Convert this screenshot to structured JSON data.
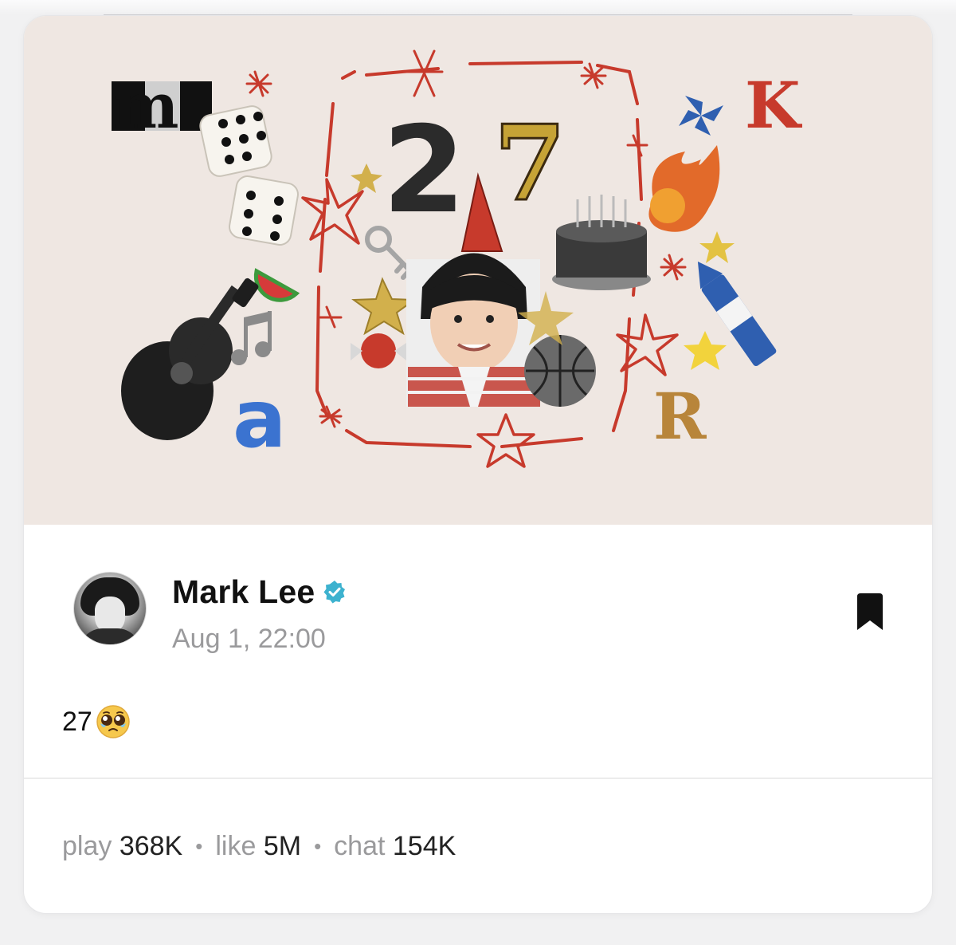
{
  "post": {
    "author_name": "Mark Lee",
    "timestamp": "Aug 1, 22:00",
    "text": "27",
    "emoji": "pleading-face-with-tears",
    "verified": true,
    "banner": {
      "letters": [
        "m",
        "a",
        "K",
        "R"
      ],
      "number": "27"
    }
  },
  "stats": {
    "play_label": "play",
    "play_value": "368K",
    "like_label": "like",
    "like_value": "5M",
    "chat_label": "chat",
    "chat_value": "154K",
    "separator": "•"
  },
  "colors": {
    "banner_bg": "#efe7e2",
    "verified": "#3db2cf",
    "muted": "#9a9a9c"
  }
}
